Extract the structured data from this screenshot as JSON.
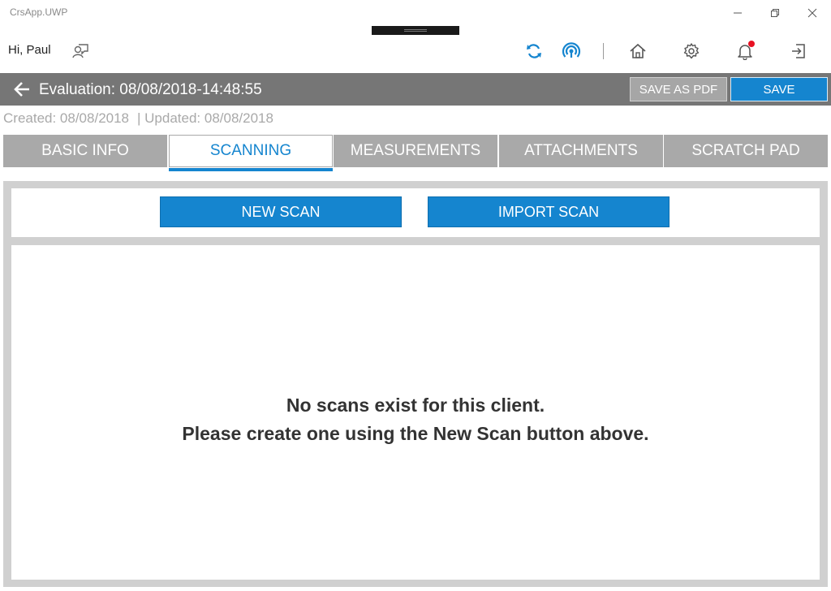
{
  "window": {
    "title": "CrsApp.UWP",
    "minimize_icon": "minimize-icon",
    "restore_icon": "restore-icon",
    "close_icon": "close-icon"
  },
  "header": {
    "greeting": "Hi, Paul",
    "icons": [
      "user-feedback-icon",
      "sync-icon",
      "broadcast-icon",
      "home-icon",
      "gear-icon",
      "bell-icon",
      "sign-out-icon"
    ],
    "accent": "#1585cf",
    "notification_dot_color": "#e81123"
  },
  "evaluation": {
    "title": "Evaluation: 08/08/2018-14:48:55",
    "save_pdf_label": "SAVE AS PDF",
    "save_label": "SAVE",
    "created": "Created: 08/08/2018",
    "updated": "| Updated: 08/08/2018"
  },
  "tabs": [
    {
      "label": "BASIC INFO"
    },
    {
      "label": "SCANNING",
      "active": true
    },
    {
      "label": "MEASUREMENTS"
    },
    {
      "label": "ATTACHMENTS"
    },
    {
      "label": "SCRATCH PAD"
    }
  ],
  "scanning": {
    "new_scan_label": "NEW SCAN",
    "import_scan_label": "IMPORT SCAN",
    "empty_line1": "No scans exist for this client.",
    "empty_line2": "Please create one using the New Scan button above."
  }
}
